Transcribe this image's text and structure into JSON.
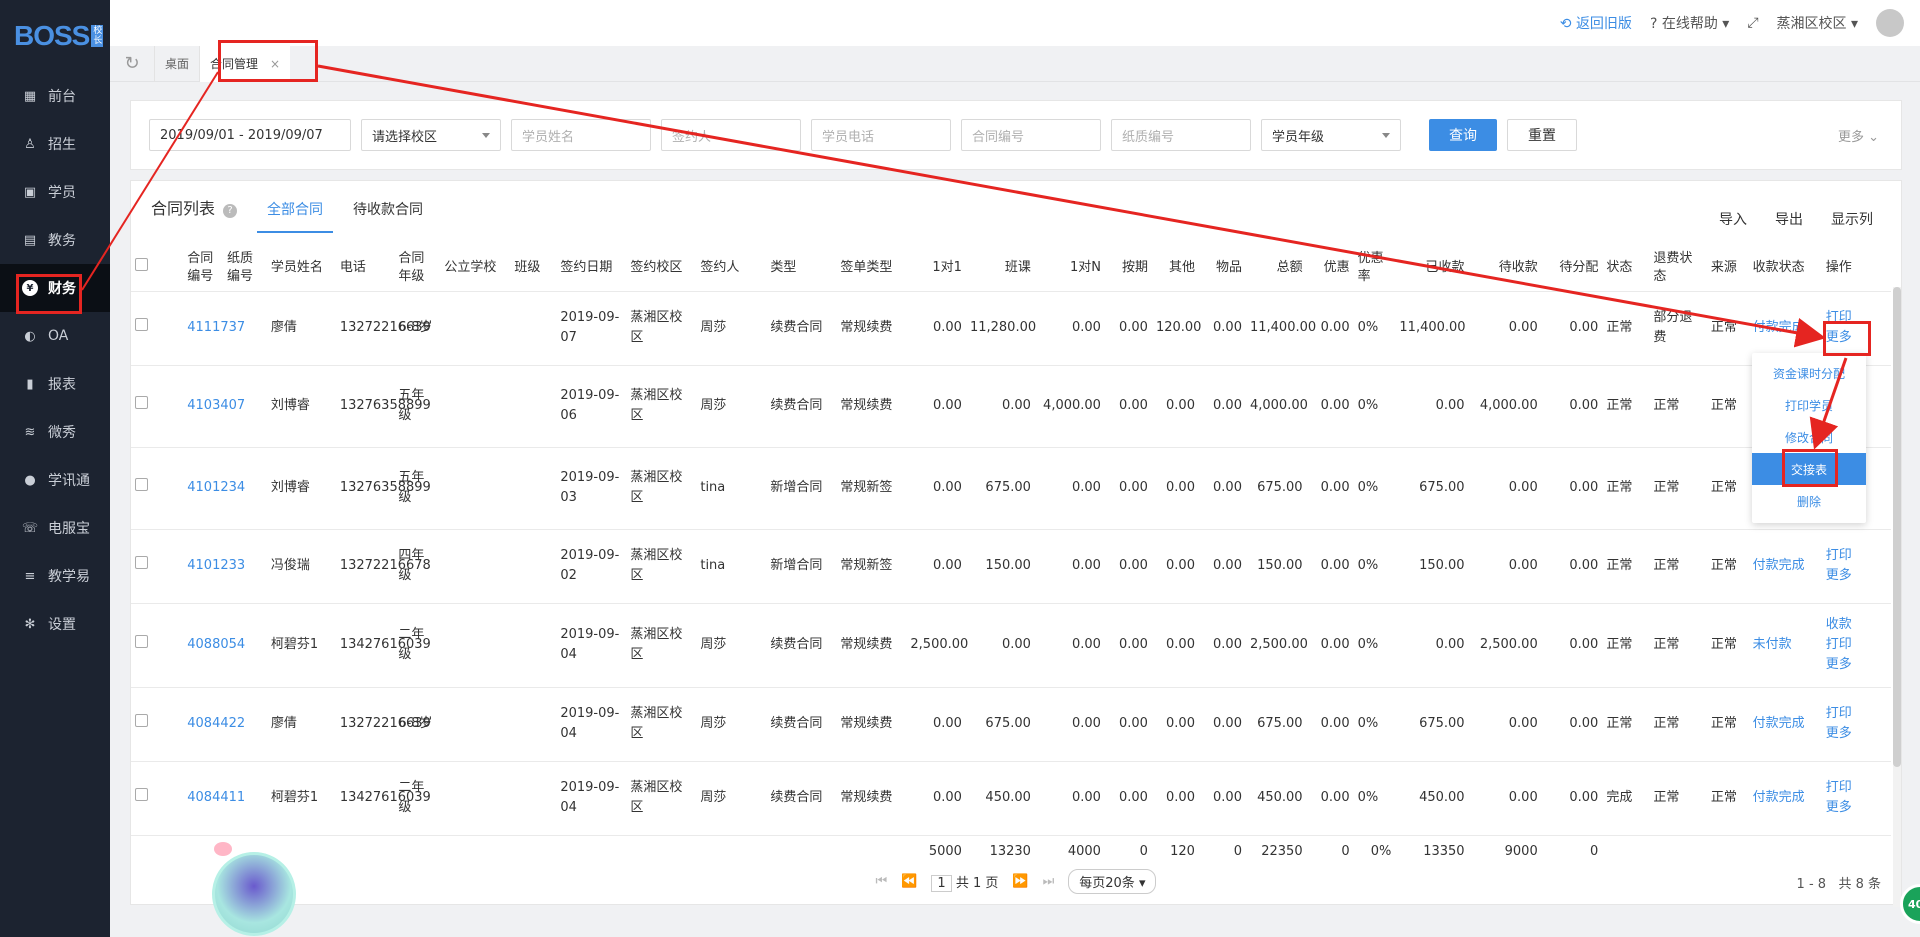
{
  "app": {
    "logo": "BOSS",
    "logo_badge": "校长"
  },
  "sidebar": {
    "items": [
      {
        "label": "前台",
        "icon": "calendar-icon"
      },
      {
        "label": "招生",
        "icon": "user-plus-icon"
      },
      {
        "label": "学员",
        "icon": "id-card-icon"
      },
      {
        "label": "教务",
        "icon": "book-icon"
      },
      {
        "label": "财务",
        "icon": "yen-coin-icon"
      },
      {
        "label": "OA",
        "icon": "toggle-icon"
      },
      {
        "label": "报表",
        "icon": "bar-chart-icon"
      },
      {
        "label": "微秀",
        "icon": "wave-icon"
      },
      {
        "label": "学讯通",
        "icon": "location-pin-icon"
      },
      {
        "label": "电服宝",
        "icon": "phone-icon"
      },
      {
        "label": "教学易",
        "icon": "layers-icon"
      },
      {
        "label": "设置",
        "icon": "gear-icon"
      }
    ],
    "active_index": 4
  },
  "topbar": {
    "back_old": "返回旧版",
    "help": "在线帮助",
    "campus": "蒸湘区校区"
  },
  "tabs": {
    "desk": "桌面",
    "current": "合同管理",
    "close": "×"
  },
  "filter": {
    "date_range": "2019/09/01 - 2019/09/07",
    "campus_placeholder": "请选择校区",
    "student_name_placeholder": "学员姓名",
    "signer_placeholder": "签约人",
    "phone_placeholder": "学员电话",
    "contract_no_placeholder": "合同编号",
    "paper_no_placeholder": "纸质编号",
    "grade_placeholder": "学员年级",
    "query": "查询",
    "reset": "重置",
    "more": "更多"
  },
  "panel": {
    "title": "合同列表",
    "tab_all": "全部合同",
    "tab_pending": "待收款合同",
    "import": "导入",
    "export": "导出",
    "show_cols": "显示列"
  },
  "columns": [
    "合同编号",
    "纸质编号",
    "学员姓名",
    "电话",
    "合同年级",
    "公立学校",
    "班级",
    "签约日期",
    "签约校区",
    "签约人",
    "类型",
    "签单类型",
    "1对1",
    "班课",
    "1对N",
    "按期",
    "其他",
    "物品",
    "总额",
    "优惠",
    "优惠率",
    "已收款",
    "待收款",
    "待分配",
    "状态",
    "退费状态",
    "来源",
    "收款状态",
    "操作"
  ],
  "rows": [
    {
      "no": "4111737",
      "paper": "",
      "name": "廖倩",
      "phone": "13272216639",
      "grade": "6-8岁",
      "school": "",
      "cls": "",
      "date": "2019-09-07",
      "campus": "蒸湘区校区",
      "signer": "周莎",
      "type": "续费合同",
      "sign_type": "常规续费",
      "o2o": "0.00",
      "class": "11,280.00",
      "o2n": "0.00",
      "period": "0.00",
      "other": "120.00",
      "goods": "0.00",
      "total": "11,400.00",
      "disc": "0.00",
      "disc_rate": "0%",
      "received": "11,400.00",
      "pending": "0.00",
      "alloc": "0.00",
      "status": "正常",
      "refund": "部分退费",
      "source": "正常",
      "pay_status": "付款完成",
      "ops": [
        "打印",
        "更多"
      ]
    },
    {
      "no": "4103407",
      "paper": "",
      "name": "刘博睿",
      "phone": "13276358899",
      "grade": "五年级",
      "school": "",
      "cls": "",
      "date": "2019-09-06",
      "campus": "蒸湘区校区",
      "signer": "周莎",
      "type": "续费合同",
      "sign_type": "常规续费",
      "o2o": "0.00",
      "class": "0.00",
      "o2n": "4,000.00",
      "period": "0.00",
      "other": "0.00",
      "goods": "0.00",
      "total": "4,000.00",
      "disc": "0.00",
      "disc_rate": "0%",
      "received": "0.00",
      "pending": "4,000.00",
      "alloc": "0.00",
      "status": "正常",
      "refund": "正常",
      "source": "正常",
      "pay_status": "",
      "ops": []
    },
    {
      "no": "4101234",
      "paper": "",
      "name": "刘博睿",
      "phone": "13276358899",
      "grade": "五年级",
      "school": "",
      "cls": "",
      "date": "2019-09-03",
      "campus": "蒸湘区校区",
      "signer": "tina",
      "type": "新增合同",
      "sign_type": "常规新签",
      "o2o": "0.00",
      "class": "675.00",
      "o2n": "0.00",
      "period": "0.00",
      "other": "0.00",
      "goods": "0.00",
      "total": "675.00",
      "disc": "0.00",
      "disc_rate": "0%",
      "received": "675.00",
      "pending": "0.00",
      "alloc": "0.00",
      "status": "正常",
      "refund": "正常",
      "source": "正常",
      "pay_status": "",
      "ops": []
    },
    {
      "no": "4101233",
      "paper": "",
      "name": "冯俊瑞",
      "phone": "13272216678",
      "grade": "四年级",
      "school": "",
      "cls": "",
      "date": "2019-09-02",
      "campus": "蒸湘区校区",
      "signer": "tina",
      "type": "新增合同",
      "sign_type": "常规新签",
      "o2o": "0.00",
      "class": "150.00",
      "o2n": "0.00",
      "period": "0.00",
      "other": "0.00",
      "goods": "0.00",
      "total": "150.00",
      "disc": "0.00",
      "disc_rate": "0%",
      "received": "150.00",
      "pending": "0.00",
      "alloc": "0.00",
      "status": "正常",
      "refund": "正常",
      "source": "正常",
      "pay_status": "付款完成",
      "ops": [
        "打印",
        "更多"
      ]
    },
    {
      "no": "4088054",
      "paper": "",
      "name": "柯碧芬1",
      "phone": "13427616039",
      "grade": "二年级",
      "school": "",
      "cls": "",
      "date": "2019-09-04",
      "campus": "蒸湘区校区",
      "signer": "周莎",
      "type": "续费合同",
      "sign_type": "常规续费",
      "o2o": "2,500.00",
      "class": "0.00",
      "o2n": "0.00",
      "period": "0.00",
      "other": "0.00",
      "goods": "0.00",
      "total": "2,500.00",
      "disc": "0.00",
      "disc_rate": "0%",
      "received": "0.00",
      "pending": "2,500.00",
      "alloc": "0.00",
      "status": "正常",
      "refund": "正常",
      "source": "正常",
      "pay_status": "未付款",
      "ops": [
        "收款",
        "打印",
        "更多"
      ]
    },
    {
      "no": "4084422",
      "paper": "",
      "name": "廖倩",
      "phone": "13272216639",
      "grade": "6-8岁",
      "school": "",
      "cls": "",
      "date": "2019-09-04",
      "campus": "蒸湘区校区",
      "signer": "周莎",
      "type": "续费合同",
      "sign_type": "常规续费",
      "o2o": "0.00",
      "class": "675.00",
      "o2n": "0.00",
      "period": "0.00",
      "other": "0.00",
      "goods": "0.00",
      "total": "675.00",
      "disc": "0.00",
      "disc_rate": "0%",
      "received": "675.00",
      "pending": "0.00",
      "alloc": "0.00",
      "status": "正常",
      "refund": "正常",
      "source": "正常",
      "pay_status": "付款完成",
      "ops": [
        "打印",
        "更多"
      ]
    },
    {
      "no": "4084411",
      "paper": "",
      "name": "柯碧芬1",
      "phone": "13427616039",
      "grade": "二年级",
      "school": "",
      "cls": "",
      "date": "2019-09-04",
      "campus": "蒸湘区校区",
      "signer": "周莎",
      "type": "续费合同",
      "sign_type": "常规续费",
      "o2o": "0.00",
      "class": "450.00",
      "o2n": "0.00",
      "period": "0.00",
      "other": "0.00",
      "goods": "0.00",
      "total": "450.00",
      "disc": "0.00",
      "disc_rate": "0%",
      "received": "450.00",
      "pending": "0.00",
      "alloc": "0.00",
      "status": "完成",
      "refund": "正常",
      "source": "正常",
      "pay_status": "付款完成",
      "ops": [
        "打印",
        "更多"
      ]
    }
  ],
  "totals": {
    "o2o": "5000",
    "class": "13230",
    "o2n": "4000",
    "period": "0",
    "other": "120",
    "goods": "0",
    "total": "22350",
    "disc": "0",
    "disc_rate": "0%",
    "received": "13350",
    "pending": "9000",
    "alloc": "0"
  },
  "dropdown": {
    "items": [
      "资金课时分配",
      "打印学员",
      "修改合同",
      "交接表",
      "删除"
    ],
    "selected_index": 3
  },
  "pager": {
    "page": "1",
    "total_pages": "共 1 页",
    "page_size": "每页20条",
    "range": "1 - 8",
    "count": "共 8 条"
  },
  "badge": "40",
  "colors": {
    "accent": "#3c8de4",
    "sidebar": "#1c2330",
    "annotation": "#e52521"
  }
}
